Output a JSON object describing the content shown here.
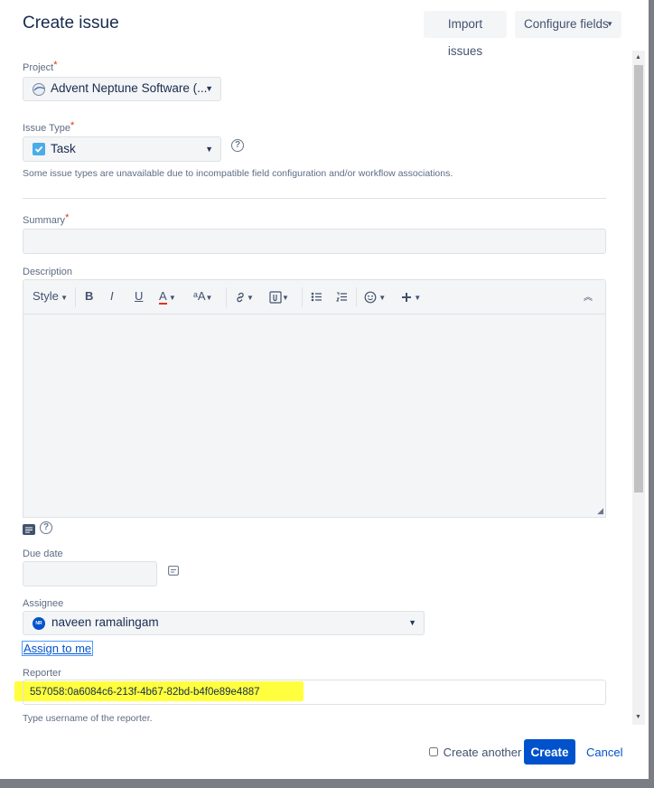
{
  "dialog": {
    "title": "Create issue",
    "import_label": "Import issues",
    "configure_label": "Configure fields"
  },
  "fields": {
    "project": {
      "label": "Project",
      "required_mark": "*",
      "value": "Advent Neptune Software (..."
    },
    "issue_type": {
      "label": "Issue Type",
      "required_mark": "*",
      "value": "Task",
      "help_glyph": "?",
      "note": "Some issue types are unavailable due to incompatible field configuration and/or workflow associations."
    },
    "summary": {
      "label": "Summary",
      "required_mark": "*",
      "value": ""
    },
    "description": {
      "label": "Description",
      "toolbar": {
        "style": "Style",
        "bold": "B",
        "italic": "I",
        "underline": "U",
        "text_color": "A",
        "text_size": "ᵃA"
      }
    },
    "due_date": {
      "label": "Due date",
      "value": ""
    },
    "assignee": {
      "label": "Assignee",
      "value": "naveen ramalingam",
      "avatar_initials": "NR",
      "assign_to_me": "Assign to me"
    },
    "reporter": {
      "label": "Reporter",
      "value": "557058:0a6084c6-213f-4b67-82bd-b4f0e89e4887",
      "note": "Type username of the reporter."
    }
  },
  "footer": {
    "create_another": "Create another",
    "create_another_checked": false,
    "create_label": "Create",
    "cancel_label": "Cancel"
  },
  "colors": {
    "primary": "#0052cc",
    "required": "#de350b",
    "highlight": "#ffff33",
    "field_bg": "#f4f5f7",
    "checkbox_blue": "#2684ff",
    "text_color_underline": "#de350b"
  },
  "icons": {
    "project": "project-avatar-icon",
    "issue_type": "task-checkbox-icon",
    "help": "help-icon",
    "calendar": "calendar-icon",
    "link": "link-icon",
    "attachment": "attachment-icon",
    "bullet_list": "bullet-list-icon",
    "numbered_list": "numbered-list-icon",
    "emoji": "emoji-icon",
    "insert_more": "plus-icon",
    "collapse": "collapse-icon"
  }
}
